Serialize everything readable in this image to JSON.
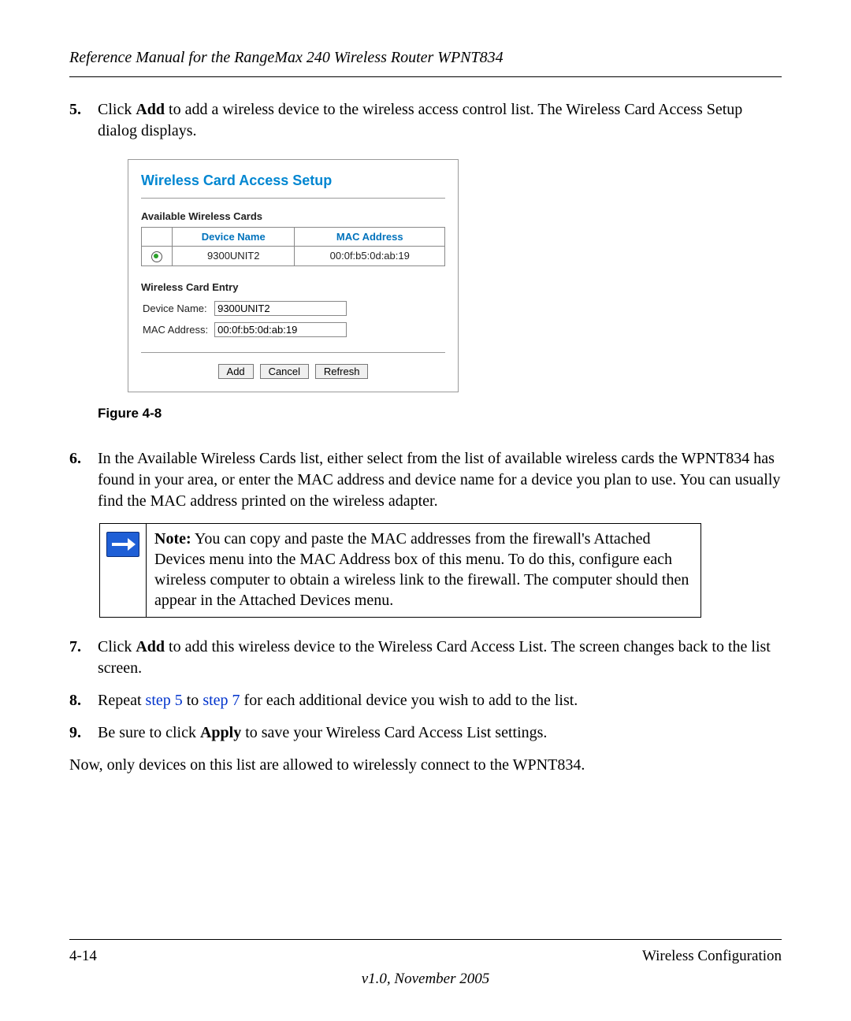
{
  "header": {
    "title": "Reference Manual for the RangeMax 240 Wireless Router WPNT834"
  },
  "steps": {
    "s5": {
      "num": "5.",
      "pre": "Click ",
      "bold": "Add",
      "post": " to add a wireless device to the wireless access control list. The Wireless Card Access Setup dialog displays."
    },
    "s6": {
      "num": "6.",
      "text": "In the Available Wireless Cards list, either select from the list of available wireless cards the WPNT834 has found in your area, or enter the MAC address and device name for a device you plan to use. You can usually find the MAC address printed on the wireless adapter."
    },
    "s7": {
      "num": "7.",
      "pre": "Click ",
      "bold": "Add",
      "post": " to add this wireless device to the Wireless Card Access List. The screen changes back to the list screen."
    },
    "s8": {
      "num": "8.",
      "pre": "Repeat ",
      "link1": "step 5",
      "mid": " to ",
      "link2": "step 7",
      "post": " for each additional device you wish to add to the list."
    },
    "s9": {
      "num": "9.",
      "pre": "Be sure to click ",
      "bold": "Apply",
      "post": " to save your Wireless Card Access List settings."
    }
  },
  "final_para": "Now, only devices on this list are allowed to wirelessly connect to the WPNT834.",
  "figure_caption": "Figure 4-8",
  "dialog": {
    "title": "Wireless Card Access Setup",
    "avail_section": "Available Wireless Cards",
    "col_device": "Device Name",
    "col_mac": "MAC Address",
    "row_device": "9300UNIT2",
    "row_mac": "00:0f:b5:0d:ab:19",
    "entry_section": "Wireless Card Entry",
    "label_device": "Device Name:",
    "label_mac": "MAC Address:",
    "input_device": "9300UNIT2",
    "input_mac": "00:0f:b5:0d:ab:19",
    "btn_add": "Add",
    "btn_cancel": "Cancel",
    "btn_refresh": "Refresh"
  },
  "note": {
    "label": "Note:",
    "text": " You can copy and paste the MAC addresses from the firewall's Attached Devices menu into the MAC Address box of this menu. To do this, configure each wireless computer to obtain a wireless link to the firewall. The computer should then appear in the Attached Devices menu."
  },
  "footer": {
    "left": "4-14",
    "right": "Wireless Configuration",
    "version": "v1.0, November 2005"
  }
}
